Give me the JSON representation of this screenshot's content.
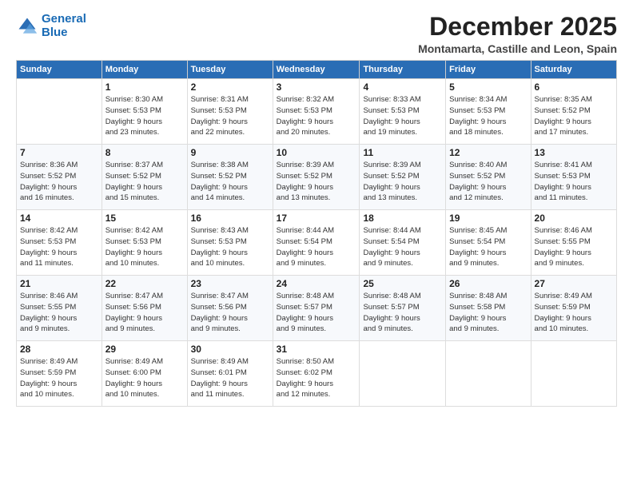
{
  "logo": {
    "line1": "General",
    "line2": "Blue"
  },
  "title": "December 2025",
  "location": "Montamarta, Castille and Leon, Spain",
  "header": {
    "days": [
      "Sunday",
      "Monday",
      "Tuesday",
      "Wednesday",
      "Thursday",
      "Friday",
      "Saturday"
    ]
  },
  "weeks": [
    [
      {
        "num": "",
        "info": ""
      },
      {
        "num": "1",
        "info": "Sunrise: 8:30 AM\nSunset: 5:53 PM\nDaylight: 9 hours\nand 23 minutes."
      },
      {
        "num": "2",
        "info": "Sunrise: 8:31 AM\nSunset: 5:53 PM\nDaylight: 9 hours\nand 22 minutes."
      },
      {
        "num": "3",
        "info": "Sunrise: 8:32 AM\nSunset: 5:53 PM\nDaylight: 9 hours\nand 20 minutes."
      },
      {
        "num": "4",
        "info": "Sunrise: 8:33 AM\nSunset: 5:53 PM\nDaylight: 9 hours\nand 19 minutes."
      },
      {
        "num": "5",
        "info": "Sunrise: 8:34 AM\nSunset: 5:53 PM\nDaylight: 9 hours\nand 18 minutes."
      },
      {
        "num": "6",
        "info": "Sunrise: 8:35 AM\nSunset: 5:52 PM\nDaylight: 9 hours\nand 17 minutes."
      }
    ],
    [
      {
        "num": "7",
        "info": "Sunrise: 8:36 AM\nSunset: 5:52 PM\nDaylight: 9 hours\nand 16 minutes."
      },
      {
        "num": "8",
        "info": "Sunrise: 8:37 AM\nSunset: 5:52 PM\nDaylight: 9 hours\nand 15 minutes."
      },
      {
        "num": "9",
        "info": "Sunrise: 8:38 AM\nSunset: 5:52 PM\nDaylight: 9 hours\nand 14 minutes."
      },
      {
        "num": "10",
        "info": "Sunrise: 8:39 AM\nSunset: 5:52 PM\nDaylight: 9 hours\nand 13 minutes."
      },
      {
        "num": "11",
        "info": "Sunrise: 8:39 AM\nSunset: 5:52 PM\nDaylight: 9 hours\nand 13 minutes."
      },
      {
        "num": "12",
        "info": "Sunrise: 8:40 AM\nSunset: 5:52 PM\nDaylight: 9 hours\nand 12 minutes."
      },
      {
        "num": "13",
        "info": "Sunrise: 8:41 AM\nSunset: 5:53 PM\nDaylight: 9 hours\nand 11 minutes."
      }
    ],
    [
      {
        "num": "14",
        "info": "Sunrise: 8:42 AM\nSunset: 5:53 PM\nDaylight: 9 hours\nand 11 minutes."
      },
      {
        "num": "15",
        "info": "Sunrise: 8:42 AM\nSunset: 5:53 PM\nDaylight: 9 hours\nand 10 minutes."
      },
      {
        "num": "16",
        "info": "Sunrise: 8:43 AM\nSunset: 5:53 PM\nDaylight: 9 hours\nand 10 minutes."
      },
      {
        "num": "17",
        "info": "Sunrise: 8:44 AM\nSunset: 5:54 PM\nDaylight: 9 hours\nand 9 minutes."
      },
      {
        "num": "18",
        "info": "Sunrise: 8:44 AM\nSunset: 5:54 PM\nDaylight: 9 hours\nand 9 minutes."
      },
      {
        "num": "19",
        "info": "Sunrise: 8:45 AM\nSunset: 5:54 PM\nDaylight: 9 hours\nand 9 minutes."
      },
      {
        "num": "20",
        "info": "Sunrise: 8:46 AM\nSunset: 5:55 PM\nDaylight: 9 hours\nand 9 minutes."
      }
    ],
    [
      {
        "num": "21",
        "info": "Sunrise: 8:46 AM\nSunset: 5:55 PM\nDaylight: 9 hours\nand 9 minutes."
      },
      {
        "num": "22",
        "info": "Sunrise: 8:47 AM\nSunset: 5:56 PM\nDaylight: 9 hours\nand 9 minutes."
      },
      {
        "num": "23",
        "info": "Sunrise: 8:47 AM\nSunset: 5:56 PM\nDaylight: 9 hours\nand 9 minutes."
      },
      {
        "num": "24",
        "info": "Sunrise: 8:48 AM\nSunset: 5:57 PM\nDaylight: 9 hours\nand 9 minutes."
      },
      {
        "num": "25",
        "info": "Sunrise: 8:48 AM\nSunset: 5:57 PM\nDaylight: 9 hours\nand 9 minutes."
      },
      {
        "num": "26",
        "info": "Sunrise: 8:48 AM\nSunset: 5:58 PM\nDaylight: 9 hours\nand 9 minutes."
      },
      {
        "num": "27",
        "info": "Sunrise: 8:49 AM\nSunset: 5:59 PM\nDaylight: 9 hours\nand 10 minutes."
      }
    ],
    [
      {
        "num": "28",
        "info": "Sunrise: 8:49 AM\nSunset: 5:59 PM\nDaylight: 9 hours\nand 10 minutes."
      },
      {
        "num": "29",
        "info": "Sunrise: 8:49 AM\nSunset: 6:00 PM\nDaylight: 9 hours\nand 10 minutes."
      },
      {
        "num": "30",
        "info": "Sunrise: 8:49 AM\nSunset: 6:01 PM\nDaylight: 9 hours\nand 11 minutes."
      },
      {
        "num": "31",
        "info": "Sunrise: 8:50 AM\nSunset: 6:02 PM\nDaylight: 9 hours\nand 12 minutes."
      },
      {
        "num": "",
        "info": ""
      },
      {
        "num": "",
        "info": ""
      },
      {
        "num": "",
        "info": ""
      }
    ]
  ]
}
